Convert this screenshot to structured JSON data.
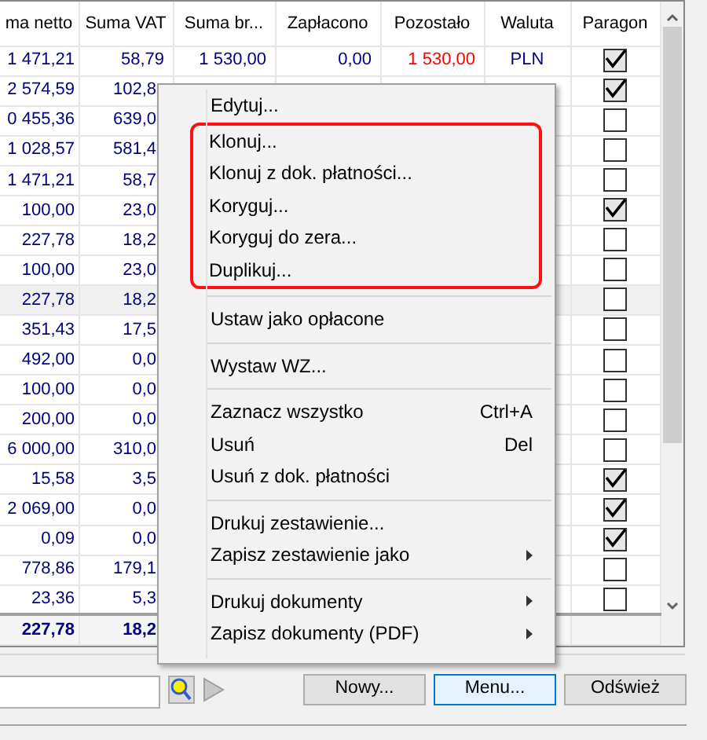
{
  "table": {
    "columns": [
      "ma netto",
      "Suma VAT",
      "Suma br...",
      "Zapłacono",
      "Pozostało",
      "Waluta",
      "Paragon"
    ],
    "rows": [
      {
        "cells": [
          "1 471,21",
          "58,79",
          "1 530,00",
          "0,00",
          "1 530,00",
          "PLN"
        ],
        "paragon": true,
        "selected": false
      },
      {
        "cells": [
          "2 574,59",
          "102,8"
        ],
        "paragon": true,
        "selected": false
      },
      {
        "cells": [
          "0 455,36",
          "639,0"
        ],
        "paragon": false,
        "selected": false
      },
      {
        "cells": [
          "1 028,57",
          "581,4"
        ],
        "paragon": false,
        "selected": false
      },
      {
        "cells": [
          "1 471,21",
          "58,7"
        ],
        "paragon": false,
        "selected": false
      },
      {
        "cells": [
          "100,00",
          "23,0"
        ],
        "paragon": true,
        "selected": false
      },
      {
        "cells": [
          "227,78",
          "18,2"
        ],
        "paragon": false,
        "selected": false
      },
      {
        "cells": [
          "100,00",
          "23,0"
        ],
        "paragon": false,
        "selected": false
      },
      {
        "cells": [
          "227,78",
          "18,2"
        ],
        "paragon": false,
        "selected": true
      },
      {
        "cells": [
          "351,43",
          "17,5"
        ],
        "paragon": false,
        "selected": false
      },
      {
        "cells": [
          "492,00",
          "0,0"
        ],
        "paragon": false,
        "selected": false
      },
      {
        "cells": [
          "100,00",
          "0,0"
        ],
        "paragon": false,
        "selected": false
      },
      {
        "cells": [
          "200,00",
          "0,0"
        ],
        "paragon": false,
        "selected": false
      },
      {
        "cells": [
          "6 000,00",
          "310,0"
        ],
        "paragon": false,
        "selected": false
      },
      {
        "cells": [
          "15,58",
          "3,5"
        ],
        "paragon": true,
        "selected": false
      },
      {
        "cells": [
          "2 069,00",
          "0,0"
        ],
        "paragon": true,
        "selected": false
      },
      {
        "cells": [
          "0,09",
          "0,0"
        ],
        "paragon": true,
        "selected": false
      },
      {
        "cells": [
          "778,86",
          "179,1"
        ],
        "paragon": false,
        "selected": false
      },
      {
        "cells": [
          "23,36",
          "5,3"
        ],
        "paragon": false,
        "selected": false
      }
    ],
    "totals": [
      "227,78",
      "18,2"
    ]
  },
  "context_menu": [
    {
      "kind": "item",
      "label": "Edytuj...",
      "highlighted": false
    },
    {
      "kind": "item",
      "label": "Klonuj...",
      "highlighted": true
    },
    {
      "kind": "item",
      "label": "Klonuj z dok. płatności...",
      "highlighted": true
    },
    {
      "kind": "item",
      "label": "Koryguj...",
      "highlighted": true
    },
    {
      "kind": "item",
      "label": "Koryguj do zera...",
      "highlighted": true
    },
    {
      "kind": "item",
      "label": "Duplikuj...",
      "highlighted": true
    },
    {
      "kind": "separator"
    },
    {
      "kind": "item",
      "label": "Ustaw jako opłacone",
      "highlighted": false
    },
    {
      "kind": "separator"
    },
    {
      "kind": "item",
      "label": "Wystaw WZ...",
      "highlighted": false
    },
    {
      "kind": "separator"
    },
    {
      "kind": "item",
      "label": "Zaznacz wszystko",
      "shortcut": "Ctrl+A",
      "highlighted": false
    },
    {
      "kind": "item",
      "label": "Usuń",
      "shortcut": "Del",
      "highlighted": false
    },
    {
      "kind": "item",
      "label": "Usuń z dok. płatności",
      "highlighted": false
    },
    {
      "kind": "separator"
    },
    {
      "kind": "item",
      "label": "Drukuj zestawienie...",
      "highlighted": false
    },
    {
      "kind": "item",
      "label": "Zapisz zestawienie jako",
      "submenu": true,
      "highlighted": false
    },
    {
      "kind": "separator"
    },
    {
      "kind": "item",
      "label": "Drukuj dokumenty",
      "submenu": true,
      "highlighted": false
    },
    {
      "kind": "item",
      "label": "Zapisz dokumenty (PDF)",
      "submenu": true,
      "highlighted": false
    }
  ],
  "buttons": [
    {
      "label": "Nowy...",
      "focused": false
    },
    {
      "label": "Menu...",
      "focused": true
    },
    {
      "label": "Odśwież",
      "focused": false
    }
  ]
}
